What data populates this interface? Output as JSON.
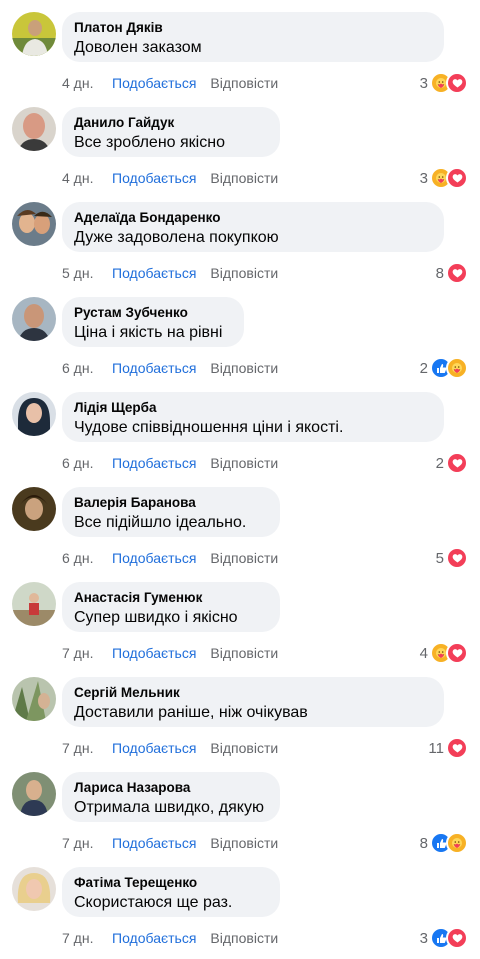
{
  "labels": {
    "like": "Подобається",
    "reply": "Відповісти"
  },
  "colors": {
    "like_link": "#216fdb",
    "bubble_bg": "#f0f2f5",
    "heart": "#f33e58",
    "care": "#f7b125",
    "thumbs_up": "#1877f2",
    "muted_text": "#65676b"
  },
  "comments": [
    {
      "author": "Платон Дяків",
      "text": "Доволен заказом",
      "time": "4 дн.",
      "reactions_count": "3",
      "reaction_icons": [
        "care-icon",
        "heart-icon"
      ]
    },
    {
      "author": "Данило Гайдук",
      "text": "Все зроблено якісно",
      "time": "4 дн.",
      "reactions_count": "3",
      "reaction_icons": [
        "care-icon",
        "heart-icon"
      ]
    },
    {
      "author": "Аделаїда Бондаренко",
      "text": "Дуже задоволена покупкою",
      "time": "5 дн.",
      "reactions_count": "8",
      "reaction_icons": [
        "heart-icon"
      ]
    },
    {
      "author": "Рустам Зубченко",
      "text": "Ціна і якість на рівні",
      "time": "6 дн.",
      "reactions_count": "2",
      "reaction_icons": [
        "like-icon",
        "care-icon"
      ]
    },
    {
      "author": "Лідія Щерба",
      "text": "Чудове співвідношення ціни і якості.",
      "time": "6 дн.",
      "reactions_count": "2",
      "reaction_icons": [
        "heart-icon"
      ]
    },
    {
      "author": "Валерія Баранова",
      "text": "Все підійшло ідеально.",
      "time": "6 дн.",
      "reactions_count": "5",
      "reaction_icons": [
        "heart-icon"
      ]
    },
    {
      "author": "Анастасія Гуменюк",
      "text": "Супер швидко і якісно",
      "time": "7 дн.",
      "reactions_count": "4",
      "reaction_icons": [
        "care-icon",
        "heart-icon"
      ]
    },
    {
      "author": "Сергій Мельник",
      "text": "Доставили раніше, ніж очікував",
      "time": "7 дн.",
      "reactions_count": "11",
      "reaction_icons": [
        "heart-icon"
      ]
    },
    {
      "author": "Лариса Назарова",
      "text": "Отримала швидко, дякую",
      "time": "7 дн.",
      "reactions_count": "8",
      "reaction_icons": [
        "like-icon",
        "care-icon"
      ]
    },
    {
      "author": "Фатіма Терещенко",
      "text": "Скористаюся ще раз.",
      "time": "7 дн.",
      "reactions_count": "3",
      "reaction_icons": [
        "like-icon",
        "heart-icon"
      ]
    }
  ]
}
